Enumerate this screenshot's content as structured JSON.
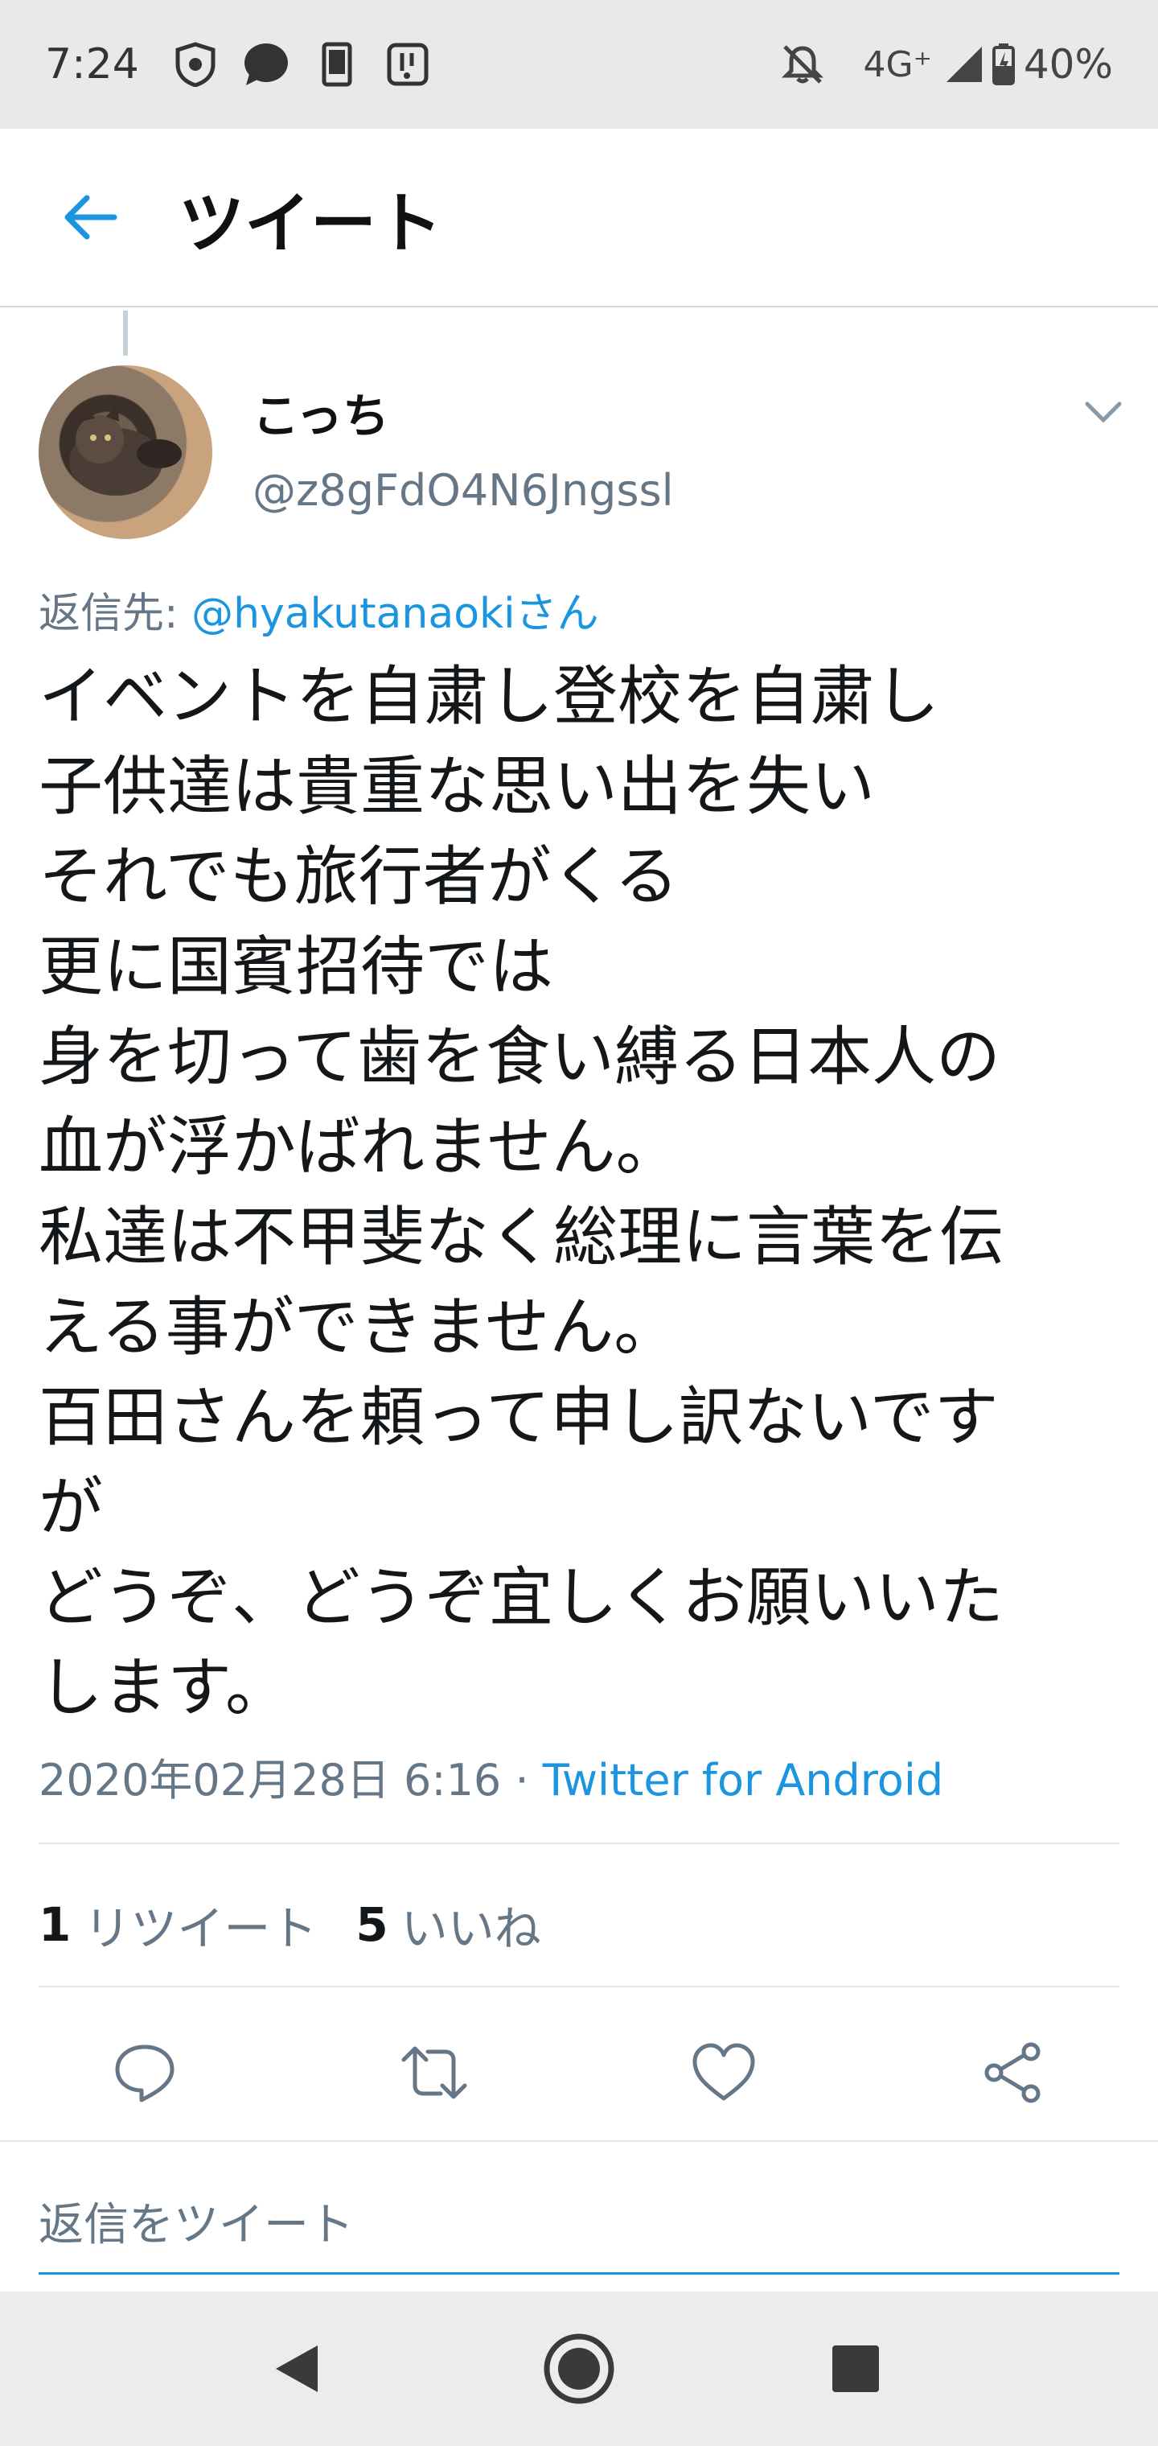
{
  "status_bar": {
    "time": "7:24",
    "network": "4G⁺",
    "battery": "40%",
    "icons": [
      "shield-icon",
      "chat-bubble-icon",
      "phone-icon",
      "hands-icon",
      "mute-notifications-icon",
      "signal-icon",
      "battery-icon"
    ]
  },
  "app_bar": {
    "title": "ツイート",
    "back_icon": "arrow-left-icon"
  },
  "tweet": {
    "author_name": "こっち",
    "author_handle": "@z8gFdO4N6Jngssl",
    "reply_prefix": "返信先: ",
    "reply_to": "@hyakutanaokiさん",
    "lines": [
      "イベントを自粛し登校を自粛し",
      "子供達は貴重な思い出を失い",
      "それでも旅行者がくる",
      "更に国賓招待では",
      "身を切って歯を食い縛る日本人の",
      "血が浮かばれません。",
      "私達は不甲斐なく総理に言葉を伝",
      "える事ができません。",
      "百田さんを頼って申し訳ないです",
      "が",
      "どうぞ、どうぞ宜しくお願いいた",
      "します。"
    ],
    "timestamp": "2020年02月28日 6:16 · ",
    "source": "Twitter for Android",
    "retweet_count": "1",
    "retweet_label": "リツイート",
    "like_count": "5",
    "like_label": "いいね"
  },
  "actions": {
    "icons": [
      "reply-icon",
      "retweet-icon",
      "like-icon",
      "share-icon"
    ]
  },
  "reply_box": {
    "placeholder": "返信をツイート"
  },
  "colors": {
    "accent": "#1b95e0",
    "secondary_text": "#657786",
    "divider": "#e1e8ed"
  }
}
